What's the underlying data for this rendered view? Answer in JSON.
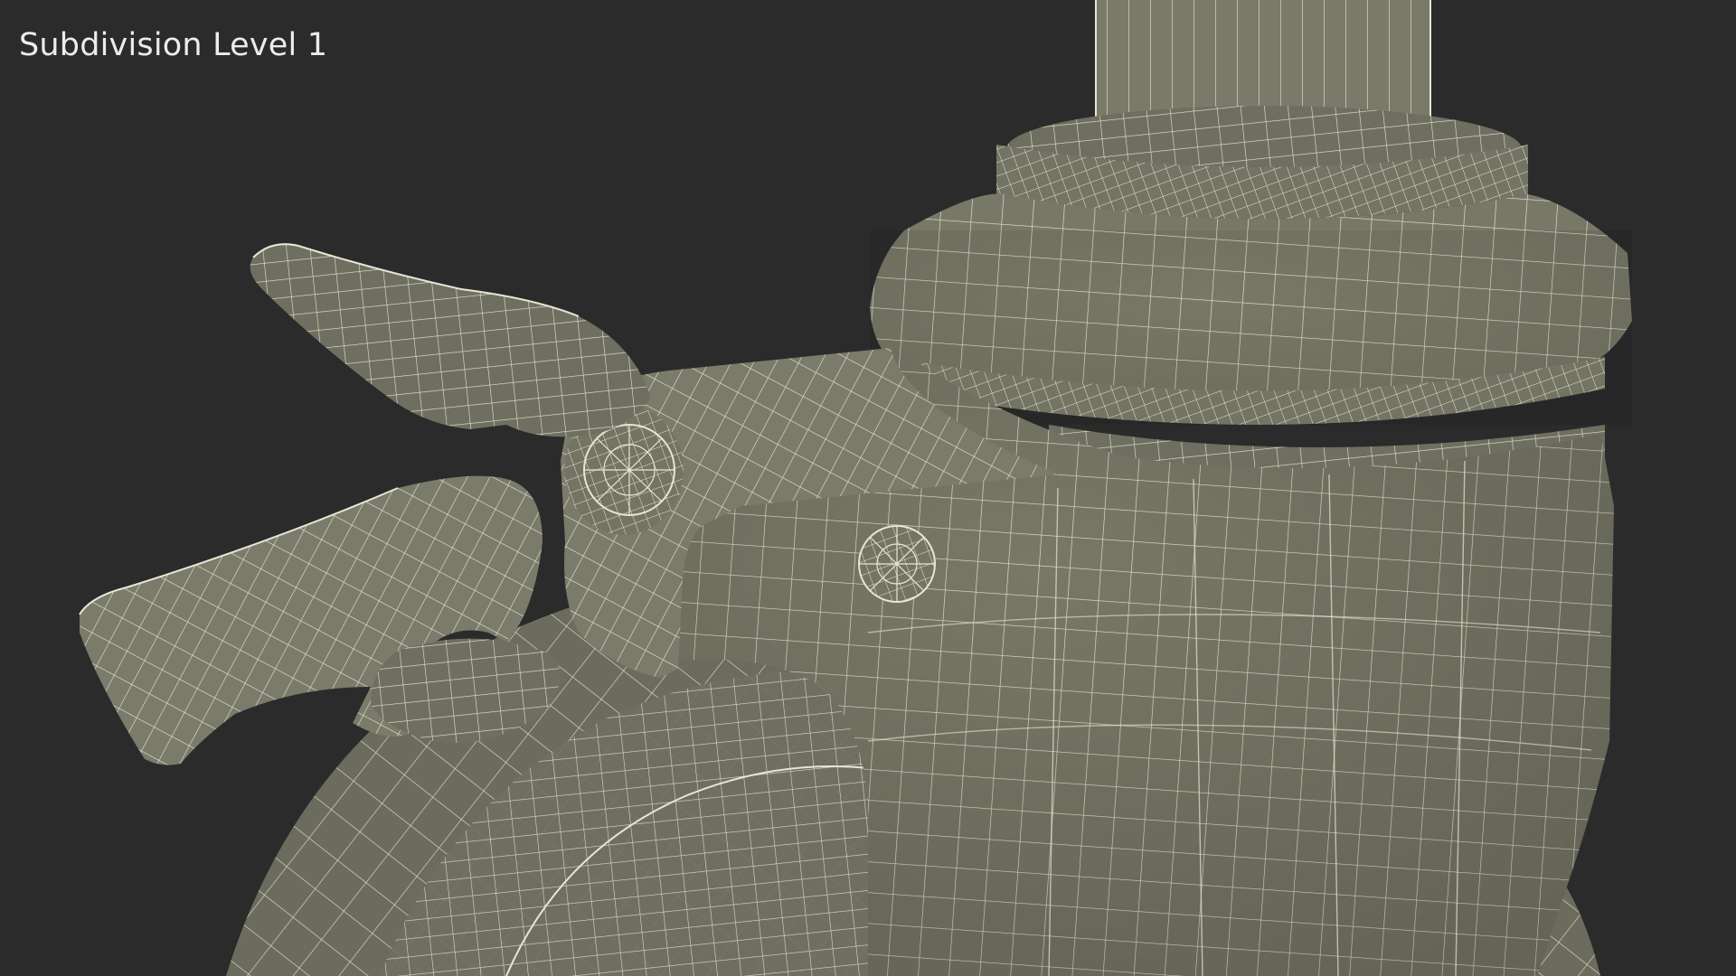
{
  "overlay": {
    "label": "Subdivision Level 1"
  },
  "scene": {
    "subject": "caster-wheel-wireframe",
    "background_color": "#2b2b2b",
    "surface_color": "#787868",
    "wire_color": "#e8e8d8"
  }
}
